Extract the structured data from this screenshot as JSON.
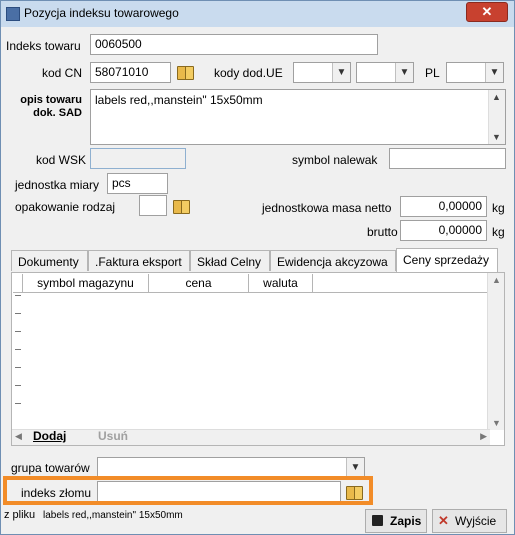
{
  "window": {
    "title": "Pozycja indeksu towarowego",
    "close_label": "✕"
  },
  "fields": {
    "indeks_towaru": {
      "label": "Indeks towaru",
      "value": "0060500"
    },
    "kod_cn": {
      "label": "kod CN",
      "value": "58071010"
    },
    "kody_dod_ue": {
      "label": "kody dod.UE",
      "value1": "",
      "value2": ""
    },
    "pl": {
      "label": "PL",
      "value": ""
    },
    "opis_towaru": {
      "label_line1": "opis towaru",
      "label_line2": "dok. SAD",
      "value": "labels red,,manstein\" 15x50mm"
    },
    "kod_wsk": {
      "label": "kod WSK",
      "value": ""
    },
    "symbol_nalewak": {
      "label": "symbol nalewak",
      "value": ""
    },
    "jednostka_miary": {
      "label": "jednostka miary",
      "value": "pcs"
    },
    "opakowanie_rodzaj": {
      "label": "opakowanie rodzaj",
      "value": ""
    },
    "masa_netto": {
      "label": "jednostkowa masa netto",
      "value": "0,00000",
      "unit": "kg"
    },
    "brutto": {
      "label": "brutto",
      "value": "0,00000",
      "unit": "kg"
    }
  },
  "tabs": [
    {
      "label": "Dokumenty"
    },
    {
      "label": ".Faktura eksport"
    },
    {
      "label": "Skład Celny"
    },
    {
      "label": "Ewidencja akcyzowa"
    },
    {
      "label": "Ceny sprzedaży"
    }
  ],
  "grid": {
    "columns": [
      "symbol magazynu",
      "cena",
      "waluta"
    ],
    "rows": []
  },
  "actions": {
    "dodaj": "Dodaj",
    "usun": "Usuń"
  },
  "grupa_towarow": {
    "label": "grupa towarów",
    "value": ""
  },
  "indeks_zlomu": {
    "label": "indeks złomu",
    "value": ""
  },
  "footer": {
    "z_pliku_label": "z pliku",
    "z_pliku_value": "labels red,,manstein\" 15x50mm",
    "zapis": "Zapis",
    "wyjscie": "Wyjście"
  }
}
